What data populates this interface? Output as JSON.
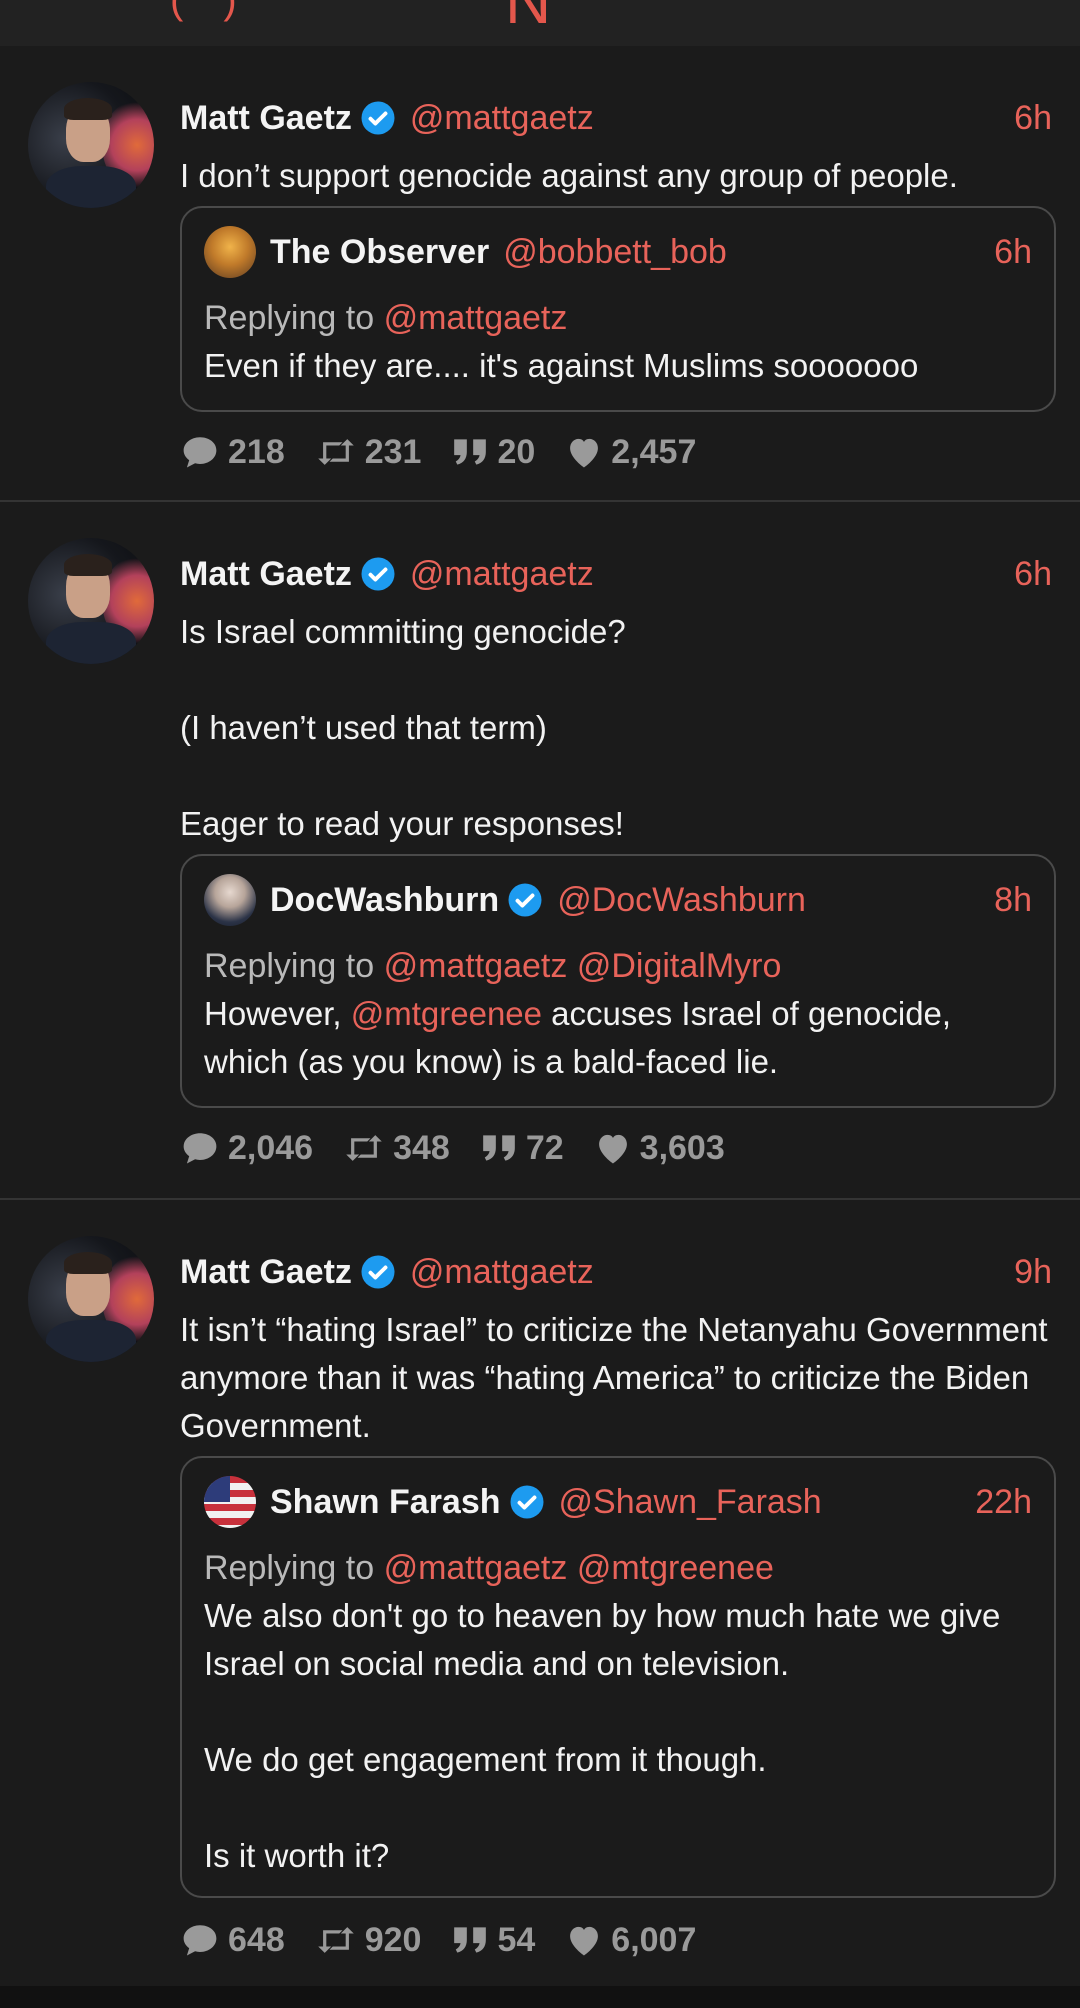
{
  "colors": {
    "background": "#1b1b1b",
    "accent": "#e8635a",
    "verified": "#1d9bf0",
    "muted": "#9a9a9a",
    "border": "#4a4a4a"
  },
  "posts": [
    {
      "author": "Matt Gaetz",
      "handle": "@mattgaetz",
      "time": "6h",
      "verified": true,
      "text": "I don’t support genocide against any group of people.",
      "quote": {
        "author": "The Observer",
        "handle": "@bobbett_bob",
        "time": "6h",
        "verified": false,
        "replying_label": "Replying to",
        "replying_to": "@mattgaetz",
        "text": "Even if they are.... it's against Muslims sooooooo"
      },
      "stats": {
        "replies": "218",
        "reposts": "231",
        "quotes": "20",
        "likes": "2,457"
      }
    },
    {
      "author": "Matt Gaetz",
      "handle": "@mattgaetz",
      "time": "6h",
      "verified": true,
      "text": "Is Israel committing genocide?\n\n(I haven’t used that term)\n\nEager to read your responses!",
      "quote": {
        "author": "DocWashburn",
        "handle": "@DocWashburn",
        "time": "8h",
        "verified": true,
        "replying_label": "Replying to",
        "replying_to": "@mattgaetz @DigitalMyro",
        "text_prefix": "However, ",
        "text_mention": "@mtgreenee",
        "text_rest": " accuses Israel of genocide, which (as you know) is a bald-faced lie."
      },
      "stats": {
        "replies": "2,046",
        "reposts": "348",
        "quotes": "72",
        "likes": "3,603"
      }
    },
    {
      "author": "Matt Gaetz",
      "handle": "@mattgaetz",
      "time": "9h",
      "verified": true,
      "text": "It isn’t “hating Israel” to criticize the Netanyahu Government anymore than it was “hating America” to criticize the Biden Government.",
      "quote": {
        "author": "Shawn Farash",
        "handle": "@Shawn_Farash",
        "time": "22h",
        "verified": true,
        "replying_label": "Replying to",
        "replying_to": "@mattgaetz @mtgreenee",
        "text": "We also don't go to heaven by how much hate we give Israel on social media and on television.\n\nWe do get engagement from it though.\n\nIs it worth it?"
      },
      "stats": {
        "replies": "648",
        "reposts": "920",
        "quotes": "54",
        "likes": "6,007"
      }
    }
  ]
}
